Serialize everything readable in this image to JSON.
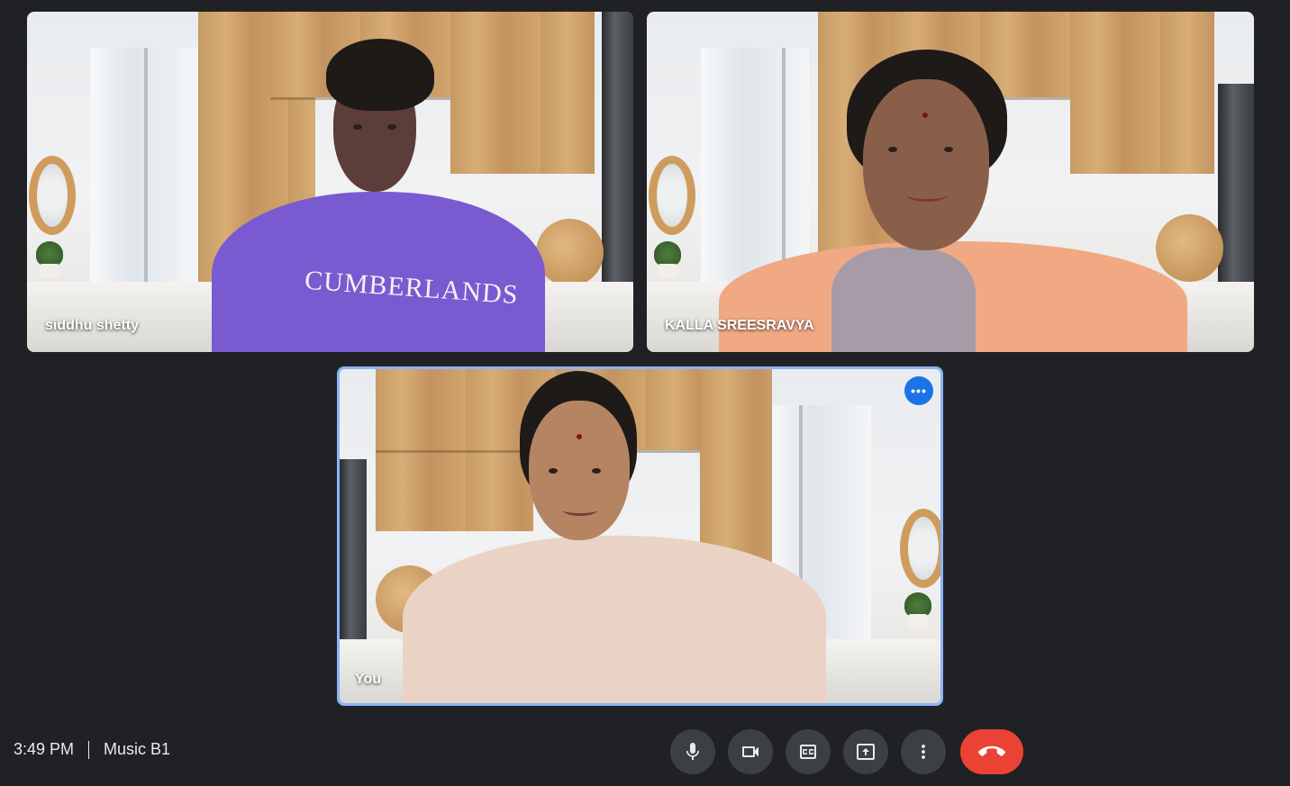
{
  "participants": [
    {
      "name": "siddhu shetty",
      "shirt_text": "CUMBERLANDS"
    },
    {
      "name": "KALLA SREESRAVYA"
    },
    {
      "name": "You"
    }
  ],
  "self_tile": {
    "more_options_icon": "more-horiz-icon",
    "highlight_color": "#8ab4f8"
  },
  "meeting": {
    "time": "3:49 PM",
    "name": "Music B1"
  },
  "controls": {
    "mic_icon": "mic-icon",
    "camera_icon": "videocam-icon",
    "captions_icon": "closed-captions-icon",
    "present_icon": "present-screen-icon",
    "more_icon": "more-vert-icon",
    "end_call_icon": "call-end-icon",
    "end_call_color": "#ea4335"
  }
}
